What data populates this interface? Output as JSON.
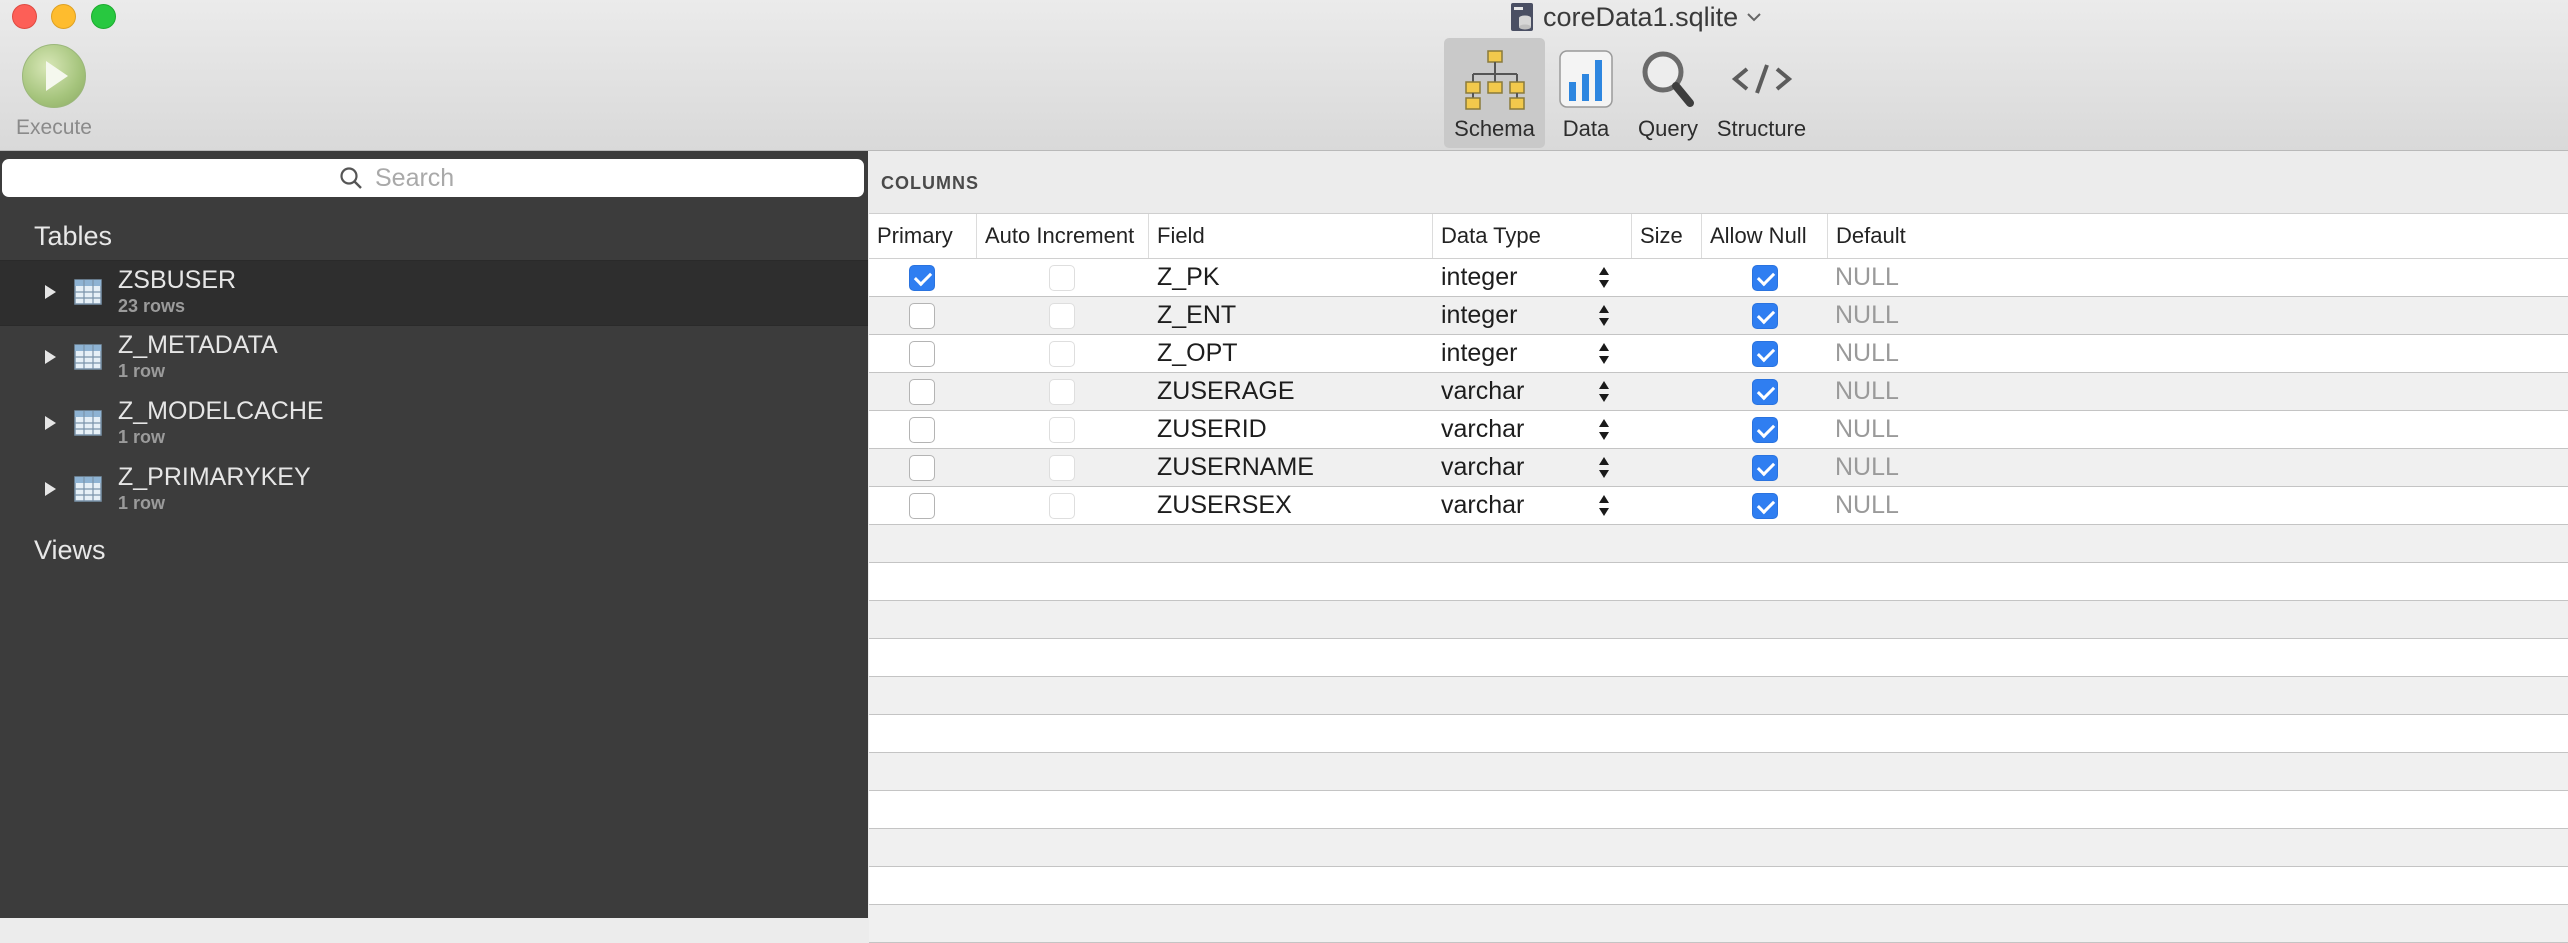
{
  "window": {
    "title": "coreData1.sqlite"
  },
  "toolbar": {
    "execute_label": "Execute",
    "tabs": [
      {
        "label": "Schema",
        "active": true
      },
      {
        "label": "Data",
        "active": false
      },
      {
        "label": "Query",
        "active": false
      },
      {
        "label": "Structure",
        "active": false
      }
    ]
  },
  "sidebar": {
    "search_placeholder": "Search",
    "tables_heading": "Tables",
    "views_heading": "Views",
    "tables": [
      {
        "name": "ZSBUSER",
        "rows": "23 rows",
        "selected": true
      },
      {
        "name": "Z_METADATA",
        "rows": "1 row",
        "selected": false
      },
      {
        "name": "Z_MODELCACHE",
        "rows": "1 row",
        "selected": false
      },
      {
        "name": "Z_PRIMARYKEY",
        "rows": "1 row",
        "selected": false
      }
    ]
  },
  "main": {
    "section_label": "COLUMNS",
    "headers": {
      "primary": "Primary",
      "auto_increment": "Auto Increment",
      "field": "Field",
      "data_type": "Data Type",
      "size": "Size",
      "allow_null": "Allow Null",
      "default": "Default"
    },
    "columns": [
      {
        "primary": true,
        "field": "Z_PK",
        "type": "integer",
        "allow_null": true,
        "default": "NULL"
      },
      {
        "primary": false,
        "field": "Z_ENT",
        "type": "integer",
        "allow_null": true,
        "default": "NULL"
      },
      {
        "primary": false,
        "field": "Z_OPT",
        "type": "integer",
        "allow_null": true,
        "default": "NULL"
      },
      {
        "primary": false,
        "field": "ZUSERAGE",
        "type": "varchar",
        "allow_null": true,
        "default": "NULL"
      },
      {
        "primary": false,
        "field": "ZUSERID",
        "type": "varchar",
        "allow_null": true,
        "default": "NULL"
      },
      {
        "primary": false,
        "field": "ZUSERNAME",
        "type": "varchar",
        "allow_null": true,
        "default": "NULL"
      },
      {
        "primary": false,
        "field": "ZUSERSEX",
        "type": "varchar",
        "allow_null": true,
        "default": "NULL"
      }
    ]
  },
  "colors": {
    "accent": "#2f7ef1",
    "sidebar_bg": "#3c3c3c"
  }
}
